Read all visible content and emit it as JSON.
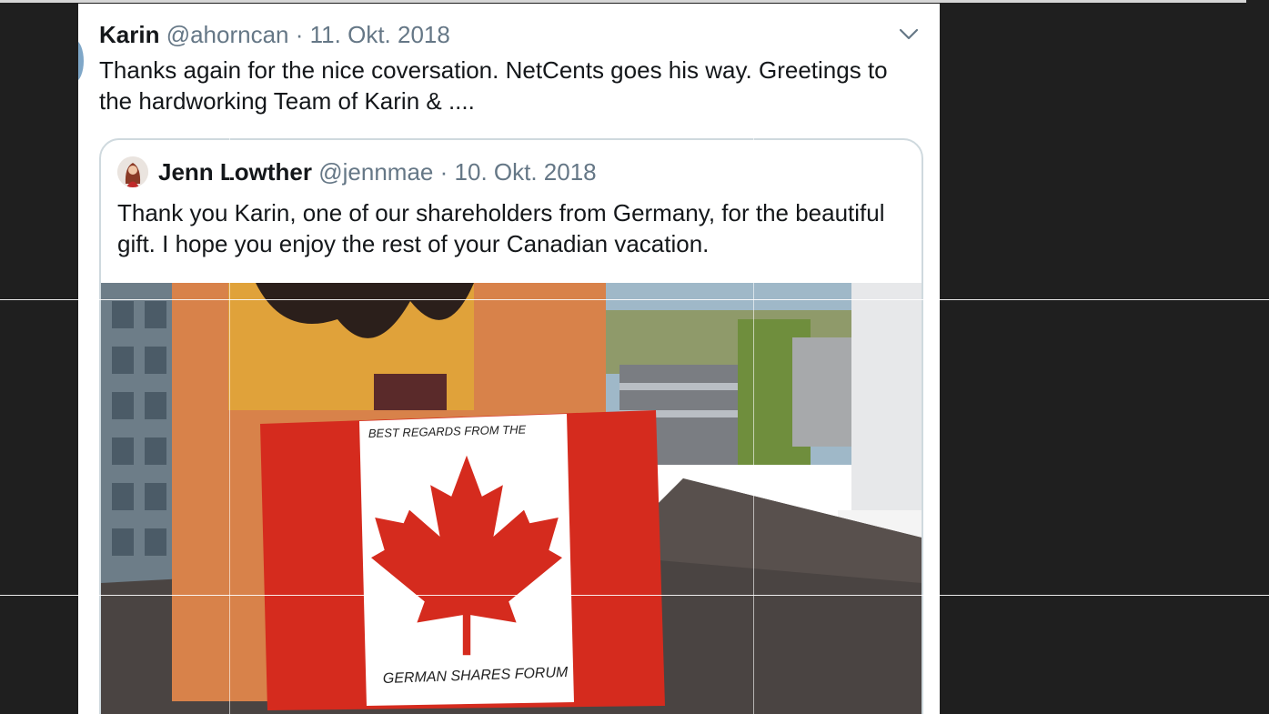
{
  "tweet": {
    "author_name": "Karin",
    "handle": "@ahorncan",
    "separator": "·",
    "date": "11. Okt. 2018",
    "text": "Thanks again for the nice coversation. NetCents goes his way. Greetings to the hardworking Team of Karin & ....",
    "menu_icon": "chevron-down-icon"
  },
  "quoted_tweet": {
    "author_name": "Jenn Lowther",
    "handle": "@jennmae",
    "separator": "·",
    "date": "10. Okt. 2018",
    "text": "Thank you Karin, one of our shareholders from Germany, for the beautiful gift. I hope you enjoy the rest of your Canadian vacation.",
    "image": {
      "card_top_text": "BEST REGARDS FROM THE",
      "card_bottom_text": "GERMAN SHARES FORUM"
    }
  },
  "colors": {
    "background": "#1f1f1f",
    "card": "#ffffff",
    "text_primary": "#14171a",
    "text_secondary": "#657786",
    "flag_red": "#d52b1e"
  }
}
